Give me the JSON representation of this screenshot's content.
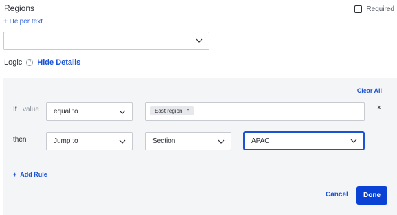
{
  "field": {
    "title": "Regions",
    "required_label": "Required",
    "helper_text": "+ Helper text",
    "select_value": ""
  },
  "logic": {
    "label": "Logic",
    "hide_details": "Hide Details",
    "clear_all": "Clear All"
  },
  "rule": {
    "if_label": "If",
    "value_label": "value",
    "operator": "equal to",
    "chip": "East region",
    "chip_remove": "×",
    "remove": "×",
    "then_label": "then",
    "action": "Jump to",
    "target_type": "Section",
    "target": "APAC"
  },
  "footer": {
    "add_rule": "Add Rule",
    "add_icon": "+",
    "cancel": "Cancel",
    "done": "Done"
  },
  "colors": {
    "accent": "#1a52d8",
    "primary_button": "#0b42d6",
    "panel_bg": "#f4f5f6"
  }
}
